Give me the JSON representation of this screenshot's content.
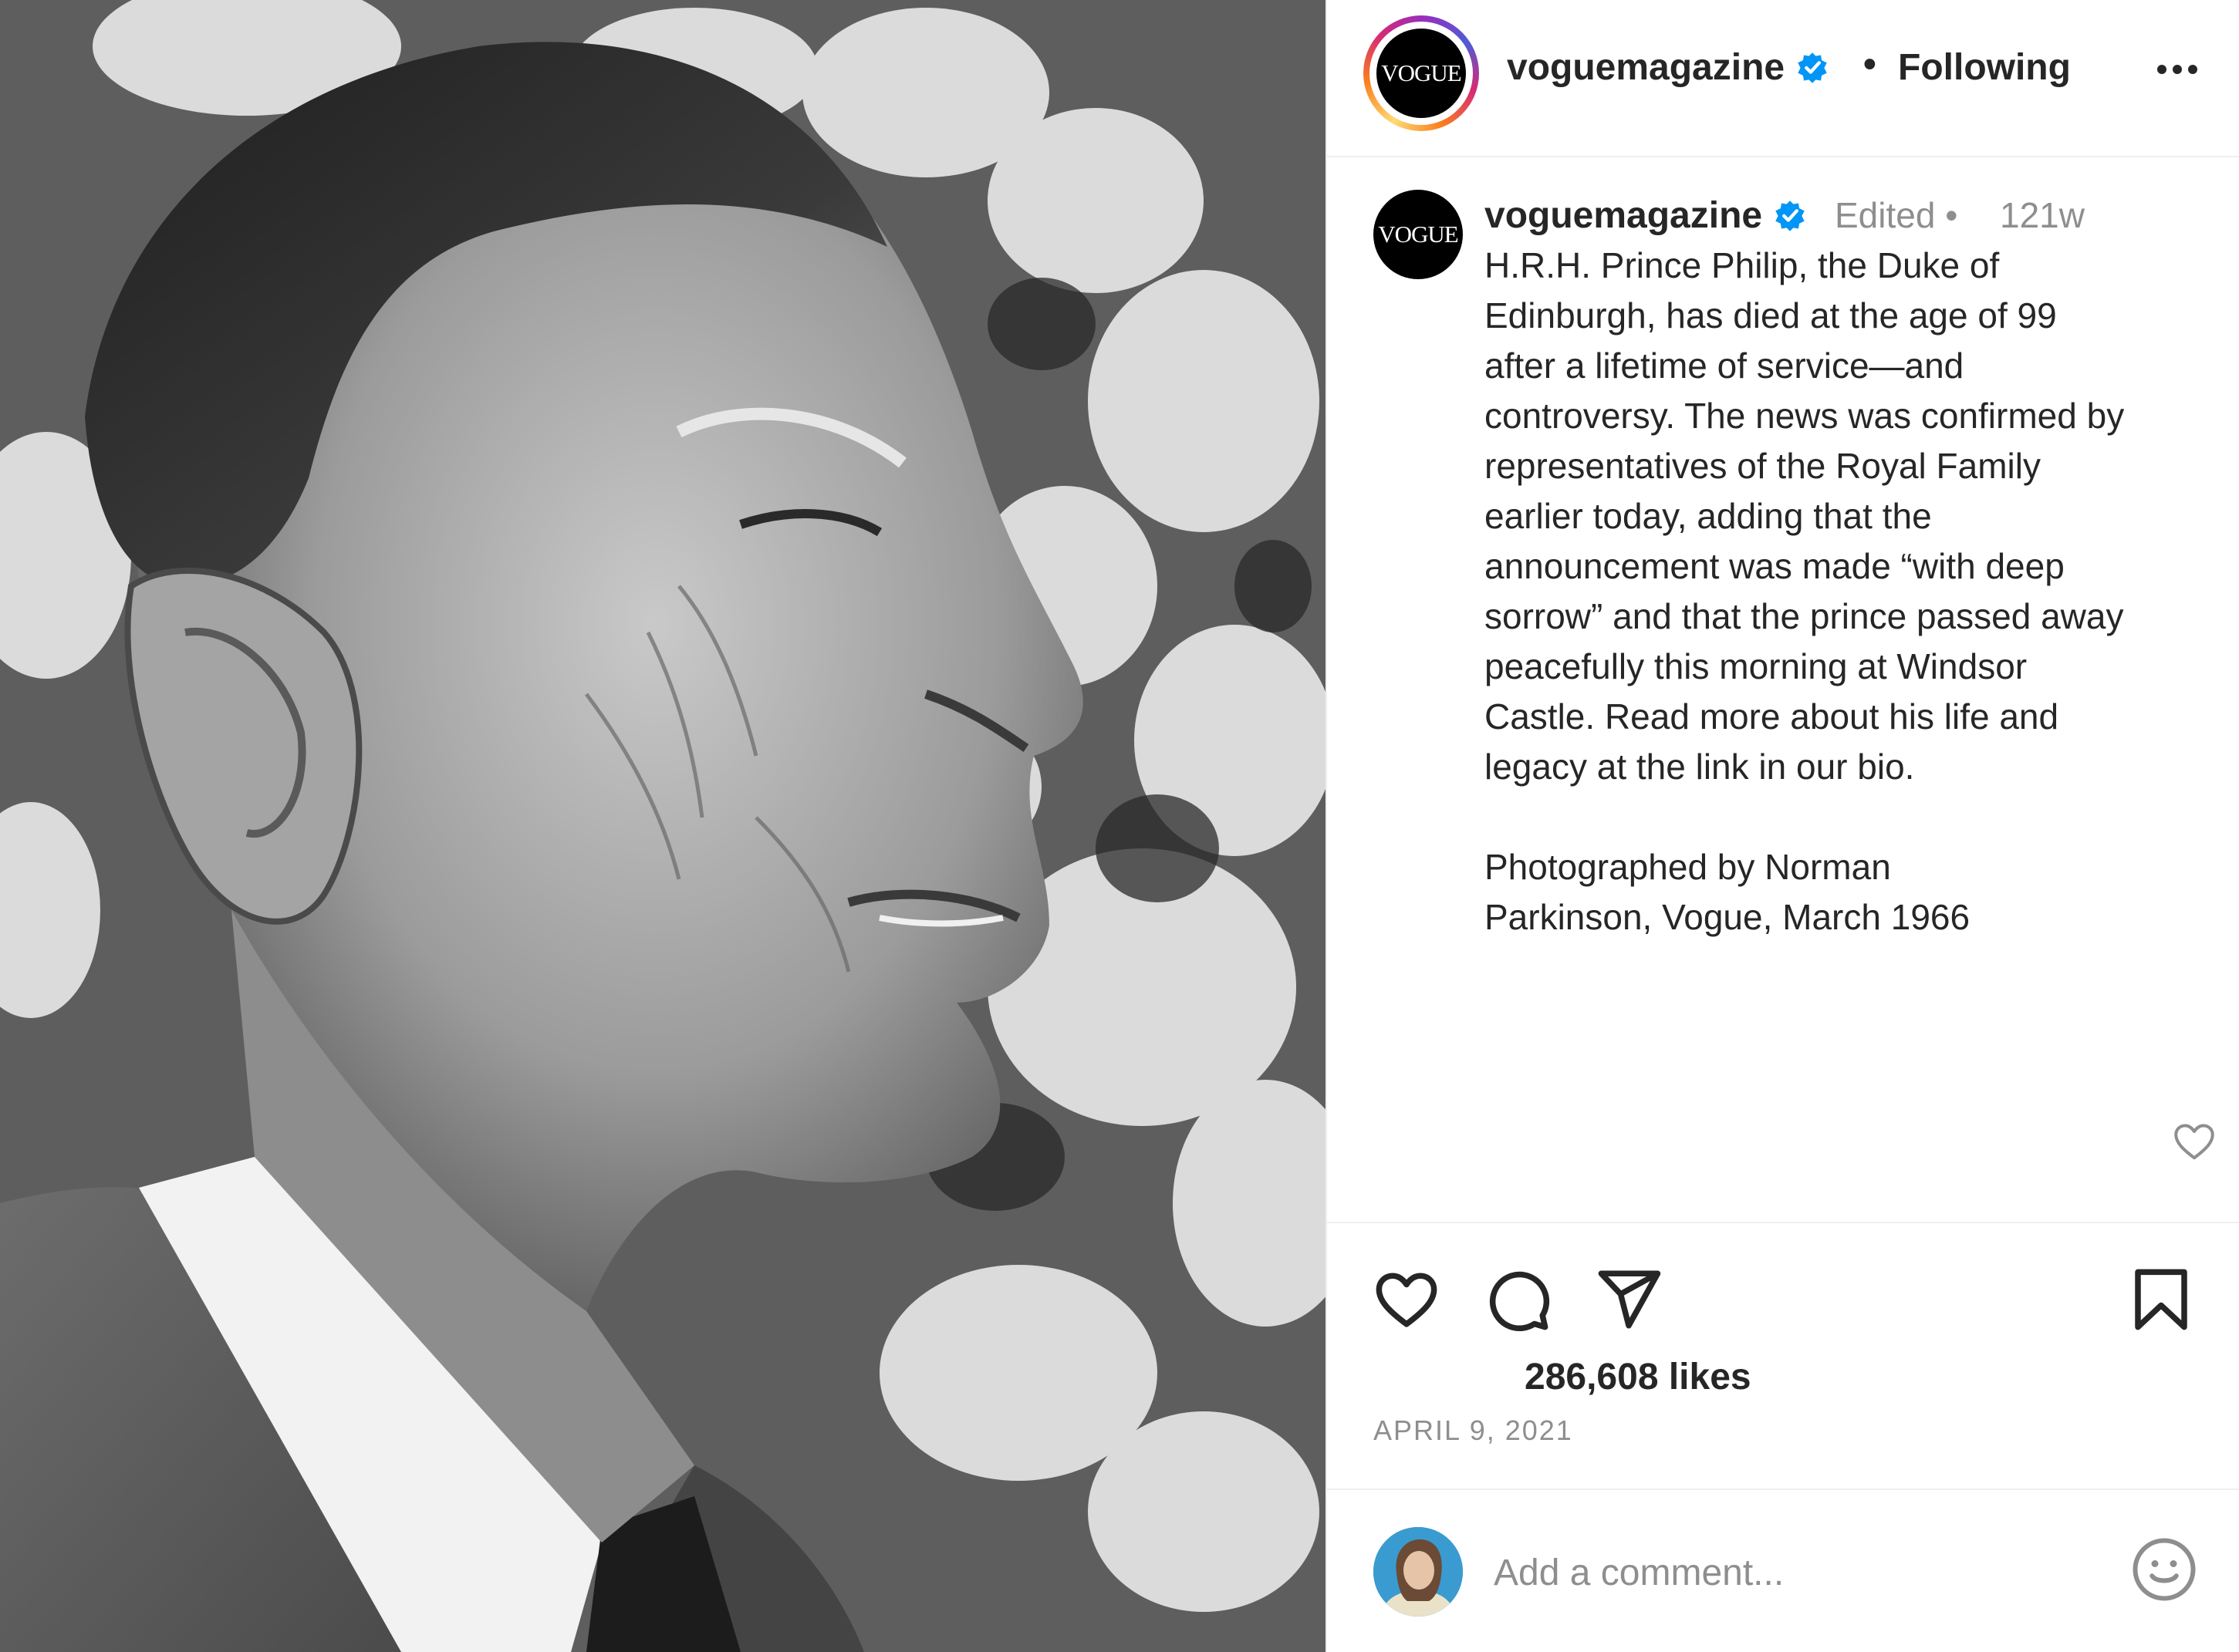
{
  "post": {
    "photo_alt": "Black and white portrait of Prince Philip in profile",
    "account": {
      "username": "voguemagazine",
      "avatar_text": "VOGUE",
      "verified_icon": "verified-badge-icon",
      "separator": "•",
      "follow_status": "Following",
      "more_icon": "more-options-icon"
    },
    "caption": {
      "username": "voguemagazine",
      "edited_label": "Edited •",
      "age": "121w",
      "text": "H.R.H. Prince Philip, the Duke of\nEdinburgh, has died at the age of 99\nafter a lifetime of service—and\ncontroversy. The news was confirmed by\nrepresentatives of the Royal Family\nearlier today, adding that the\nannouncement was made “with deep\nsorrow” and that the prince passed away\npeacefully this morning at Windsor\nCastle. Read more about his life and\nlegacy at the link in our bio.",
      "credit": "Photographed by Norman\nParkinson, Vogue, March 1966"
    },
    "actions": {
      "like_icon": "heart-icon",
      "comment_icon": "comment-icon",
      "share_icon": "share-icon",
      "save_icon": "bookmark-icon"
    },
    "likes": "286,608 likes",
    "date": "APRIL 9, 2021",
    "comment_box": {
      "placeholder": "Add a comment...",
      "emoji_icon": "emoji-icon"
    },
    "colors": {
      "verified_blue": "#0095f6",
      "text_primary": "#262626",
      "text_secondary": "#8e8e8e",
      "divider": "#efefef"
    }
  }
}
